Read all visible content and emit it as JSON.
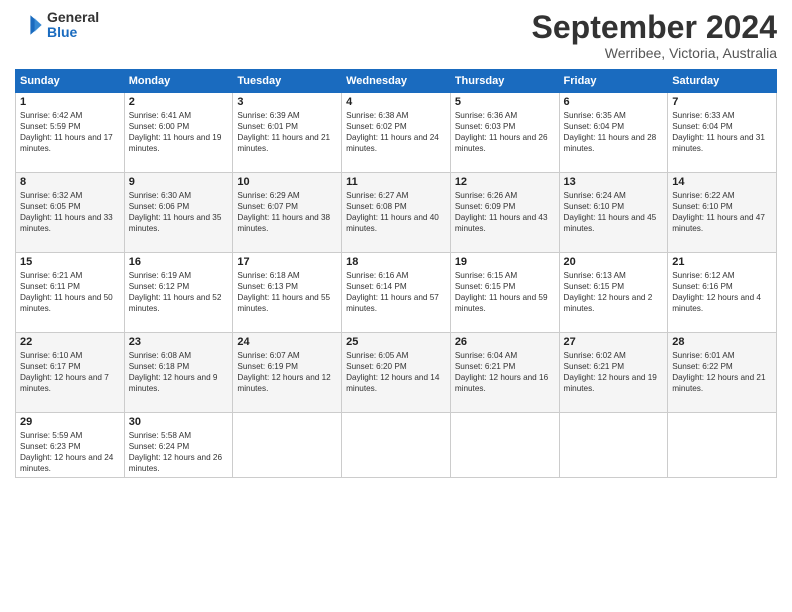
{
  "header": {
    "logo_general": "General",
    "logo_blue": "Blue",
    "title": "September 2024",
    "subtitle": "Werribee, Victoria, Australia"
  },
  "days_of_week": [
    "Sunday",
    "Monday",
    "Tuesday",
    "Wednesday",
    "Thursday",
    "Friday",
    "Saturday"
  ],
  "weeks": [
    [
      {
        "day": "1",
        "sunrise": "6:42 AM",
        "sunset": "5:59 PM",
        "daylight": "11 hours and 17 minutes."
      },
      {
        "day": "2",
        "sunrise": "6:41 AM",
        "sunset": "6:00 PM",
        "daylight": "11 hours and 19 minutes."
      },
      {
        "day": "3",
        "sunrise": "6:39 AM",
        "sunset": "6:01 PM",
        "daylight": "11 hours and 21 minutes."
      },
      {
        "day": "4",
        "sunrise": "6:38 AM",
        "sunset": "6:02 PM",
        "daylight": "11 hours and 24 minutes."
      },
      {
        "day": "5",
        "sunrise": "6:36 AM",
        "sunset": "6:03 PM",
        "daylight": "11 hours and 26 minutes."
      },
      {
        "day": "6",
        "sunrise": "6:35 AM",
        "sunset": "6:04 PM",
        "daylight": "11 hours and 28 minutes."
      },
      {
        "day": "7",
        "sunrise": "6:33 AM",
        "sunset": "6:04 PM",
        "daylight": "11 hours and 31 minutes."
      }
    ],
    [
      {
        "day": "8",
        "sunrise": "6:32 AM",
        "sunset": "6:05 PM",
        "daylight": "11 hours and 33 minutes."
      },
      {
        "day": "9",
        "sunrise": "6:30 AM",
        "sunset": "6:06 PM",
        "daylight": "11 hours and 35 minutes."
      },
      {
        "day": "10",
        "sunrise": "6:29 AM",
        "sunset": "6:07 PM",
        "daylight": "11 hours and 38 minutes."
      },
      {
        "day": "11",
        "sunrise": "6:27 AM",
        "sunset": "6:08 PM",
        "daylight": "11 hours and 40 minutes."
      },
      {
        "day": "12",
        "sunrise": "6:26 AM",
        "sunset": "6:09 PM",
        "daylight": "11 hours and 43 minutes."
      },
      {
        "day": "13",
        "sunrise": "6:24 AM",
        "sunset": "6:10 PM",
        "daylight": "11 hours and 45 minutes."
      },
      {
        "day": "14",
        "sunrise": "6:22 AM",
        "sunset": "6:10 PM",
        "daylight": "11 hours and 47 minutes."
      }
    ],
    [
      {
        "day": "15",
        "sunrise": "6:21 AM",
        "sunset": "6:11 PM",
        "daylight": "11 hours and 50 minutes."
      },
      {
        "day": "16",
        "sunrise": "6:19 AM",
        "sunset": "6:12 PM",
        "daylight": "11 hours and 52 minutes."
      },
      {
        "day": "17",
        "sunrise": "6:18 AM",
        "sunset": "6:13 PM",
        "daylight": "11 hours and 55 minutes."
      },
      {
        "day": "18",
        "sunrise": "6:16 AM",
        "sunset": "6:14 PM",
        "daylight": "11 hours and 57 minutes."
      },
      {
        "day": "19",
        "sunrise": "6:15 AM",
        "sunset": "6:15 PM",
        "daylight": "11 hours and 59 minutes."
      },
      {
        "day": "20",
        "sunrise": "6:13 AM",
        "sunset": "6:15 PM",
        "daylight": "12 hours and 2 minutes."
      },
      {
        "day": "21",
        "sunrise": "6:12 AM",
        "sunset": "6:16 PM",
        "daylight": "12 hours and 4 minutes."
      }
    ],
    [
      {
        "day": "22",
        "sunrise": "6:10 AM",
        "sunset": "6:17 PM",
        "daylight": "12 hours and 7 minutes."
      },
      {
        "day": "23",
        "sunrise": "6:08 AM",
        "sunset": "6:18 PM",
        "daylight": "12 hours and 9 minutes."
      },
      {
        "day": "24",
        "sunrise": "6:07 AM",
        "sunset": "6:19 PM",
        "daylight": "12 hours and 12 minutes."
      },
      {
        "day": "25",
        "sunrise": "6:05 AM",
        "sunset": "6:20 PM",
        "daylight": "12 hours and 14 minutes."
      },
      {
        "day": "26",
        "sunrise": "6:04 AM",
        "sunset": "6:21 PM",
        "daylight": "12 hours and 16 minutes."
      },
      {
        "day": "27",
        "sunrise": "6:02 AM",
        "sunset": "6:21 PM",
        "daylight": "12 hours and 19 minutes."
      },
      {
        "day": "28",
        "sunrise": "6:01 AM",
        "sunset": "6:22 PM",
        "daylight": "12 hours and 21 minutes."
      }
    ],
    [
      {
        "day": "29",
        "sunrise": "5:59 AM",
        "sunset": "6:23 PM",
        "daylight": "12 hours and 24 minutes."
      },
      {
        "day": "30",
        "sunrise": "5:58 AM",
        "sunset": "6:24 PM",
        "daylight": "12 hours and 26 minutes."
      },
      null,
      null,
      null,
      null,
      null
    ]
  ]
}
